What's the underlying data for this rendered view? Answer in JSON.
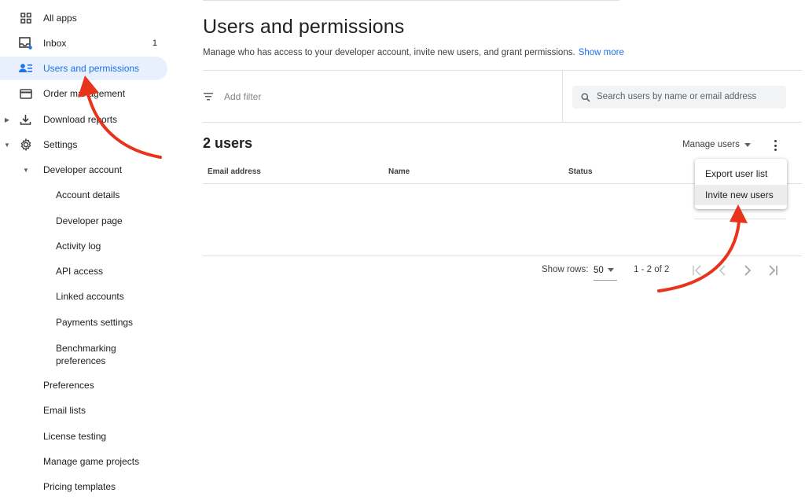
{
  "sidebar": {
    "items": [
      {
        "label": "All apps",
        "icon": "grid-icon"
      },
      {
        "label": "Inbox",
        "icon": "inbox-icon",
        "badge": "1"
      },
      {
        "label": "Users and permissions",
        "icon": "users-permissions-icon",
        "active": true
      },
      {
        "label": "Order management",
        "icon": "credit-card-icon"
      },
      {
        "label": "Download reports",
        "icon": "download-icon"
      },
      {
        "label": "Settings",
        "icon": "gear-icon"
      },
      {
        "label": "Developer account"
      },
      {
        "label": "Account details"
      },
      {
        "label": "Developer page"
      },
      {
        "label": "Activity log"
      },
      {
        "label": "API access"
      },
      {
        "label": "Linked accounts"
      },
      {
        "label": "Payments settings"
      },
      {
        "label": "Benchmarking preferences"
      },
      {
        "label": "Preferences"
      },
      {
        "label": "Email lists"
      },
      {
        "label": "License testing"
      },
      {
        "label": "Manage game projects"
      },
      {
        "label": "Pricing templates"
      }
    ]
  },
  "header": {
    "title": "Users and permissions",
    "description": "Manage who has access to your developer account, invite new users, and grant permissions.",
    "show_more": "Show more"
  },
  "filters": {
    "add_filter": "Add filter",
    "search_placeholder": "Search users by name or email address"
  },
  "users": {
    "count_label": "2 users",
    "manage_users_label": "Manage users",
    "columns": [
      "Email address",
      "Name",
      "Status"
    ],
    "menu": [
      "Export user list",
      "Invite new users"
    ]
  },
  "pagination": {
    "show_rows_label": "Show rows:",
    "rows_value": "50",
    "range": "1 - 2 of 2"
  },
  "colors": {
    "accent": "#1a73e8",
    "active_bg": "#e8f0fe",
    "annotation_arrow": "#e8341c"
  }
}
